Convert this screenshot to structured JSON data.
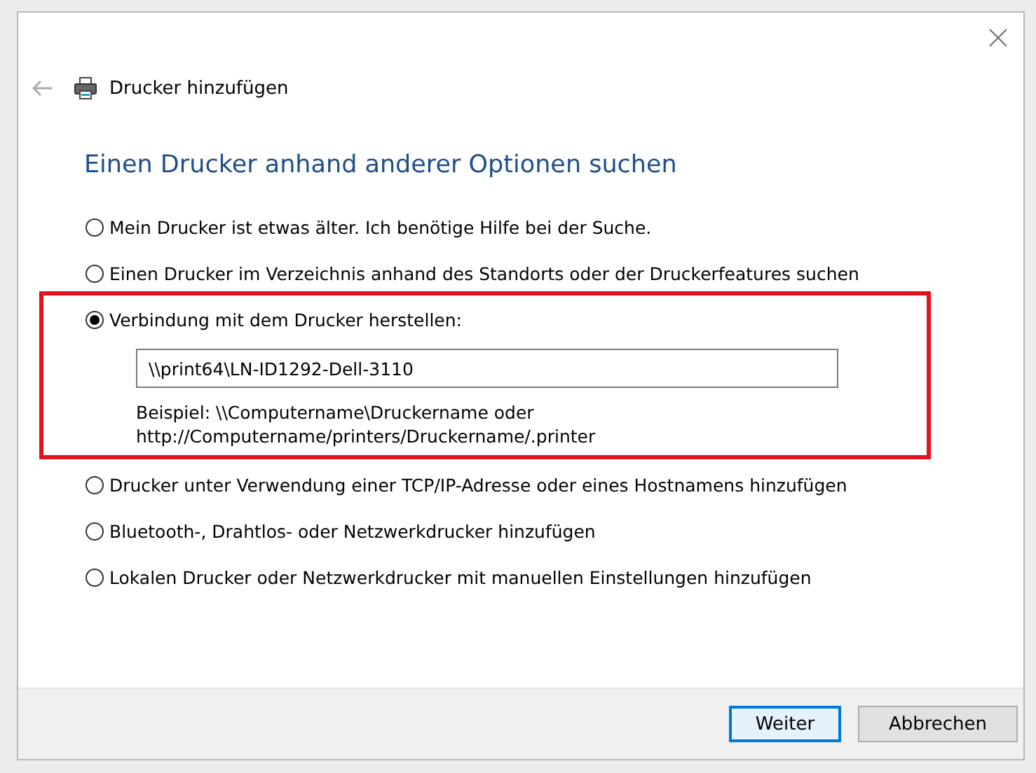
{
  "window": {
    "title": "Drucker hinzufügen"
  },
  "heading": "Einen Drucker anhand anderer Optionen suchen",
  "options": [
    {
      "label": "Mein Drucker ist etwas älter. Ich benötige Hilfe bei der Suche.",
      "selected": false,
      "highlighted": false
    },
    {
      "label": "Einen Drucker im Verzeichnis anhand des Standorts oder der Druckerfeatures suchen",
      "selected": false,
      "highlighted": false
    },
    {
      "label": "Verbindung mit dem Drucker herstellen:",
      "selected": true,
      "highlighted": true,
      "field": {
        "value": "\\\\print64\\LN-ID1292-Dell-3110"
      },
      "example": [
        "Beispiel: \\\\Computername\\Druckername oder",
        "http://Computername/printers/Druckername/.printer"
      ]
    },
    {
      "label": "Drucker unter Verwendung einer TCP/IP-Adresse oder eines Hostnamens hinzufügen",
      "selected": false,
      "highlighted": false
    },
    {
      "label": "Bluetooth-, Drahtlos- oder Netzwerkdrucker hinzufügen",
      "selected": false,
      "highlighted": false
    },
    {
      "label": "Lokalen Drucker oder Netzwerkdrucker mit manuellen Einstellungen hinzufügen",
      "selected": false,
      "highlighted": false
    }
  ],
  "buttons": [
    {
      "label": "Weiter",
      "default": true
    },
    {
      "label": "Abbrechen",
      "default": false
    }
  ]
}
